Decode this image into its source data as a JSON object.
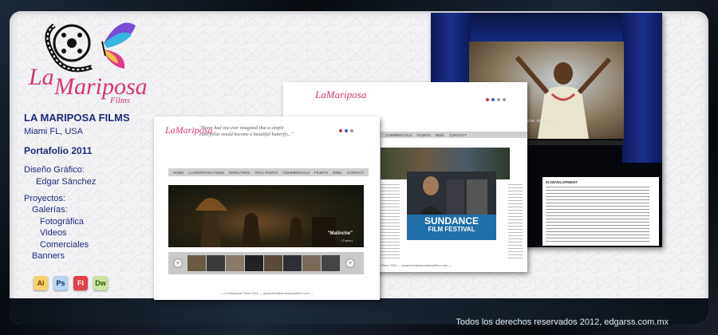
{
  "branding": {
    "logo_la": "La",
    "logo_mariposa": "Mariposa",
    "logo_films": "Films"
  },
  "info": {
    "company": "LA MARIPOSA FILMS",
    "location": "Miami FL, USA",
    "portfolio": "Portafolio 2011",
    "design_heading": "Diseño Gráfico:",
    "designer": "Edgar Sánchez",
    "projects_heading": "Proyectos:",
    "galleries": "Galerías:",
    "photo": "Fotográfica",
    "videos": "Videos",
    "commercials": "Comerciales",
    "banners": "Banners"
  },
  "apps": [
    {
      "label": "Ai",
      "icon": "illustrator-icon",
      "bg": "#f5d36a",
      "fg": "#7a3a00"
    },
    {
      "label": "Ps",
      "icon": "photoshop-icon",
      "bg": "#b9d4f2",
      "fg": "#0b2a66"
    },
    {
      "label": "Fl",
      "icon": "flash-icon",
      "bg": "#e0404a",
      "fg": "#ffffff"
    },
    {
      "label": "Dw",
      "icon": "dreamweaver-icon",
      "bg": "#cde3a0",
      "fg": "#2a5a10"
    }
  ],
  "footer": "Todos los derechos reservados 2012, edgarss.com.mx",
  "site1": {
    "quote": "\"Never had one ever imagined that a simple caterpillar would become a beautiful butterfly...\"",
    "nav": [
      "HOME",
      "LA MARIPOSA FILMS",
      "DIRECTORS",
      "STILL PHOTO",
      "COMMERCIALS",
      "FILMITS",
      "REEL",
      "CONTACT"
    ],
    "hero_caption_big": "\"Malinche\"",
    "hero_caption_small": "(Trailer)",
    "hero_caption_extra": "Yvonnea Sánchez",
    "prev": "«",
    "next": "»",
    "footer": "— La Mariposa Films 2010 — gsanchez@lamariposafilms.com —"
  },
  "site2": {
    "nav": [
      "COMMERCIALS",
      "FILMITS",
      "REEL",
      "CONTACT"
    ],
    "banner_line1": "SUNDANCE",
    "banner_line2": "FILM FESTIVAL",
    "footer": "— La Mariposa Films 2010 — gsanchez@lamariposafilms.com —"
  },
  "site3": {
    "stage_caption": "Malinche, daughter of T...",
    "dev_heading": "IN DEVELOPMENT",
    "cast_label": "CAST",
    "crew_label": "CREW",
    "project_info_label": "PROJECT INFO"
  }
}
